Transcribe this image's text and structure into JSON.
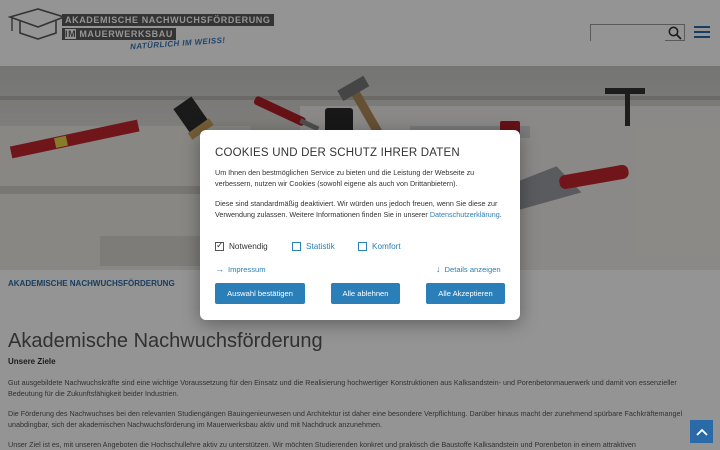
{
  "header": {
    "logo_line1": "AKADEMISCHE NACHWUCHSFÖRDERUNG",
    "logo_line2_box": "IM",
    "logo_line2": "MAUERWERKSBAU",
    "logo_tagline": "NATÜRLICH IM WEISS!",
    "search_placeholder": ""
  },
  "breadcrumb": "AKADEMISCHE NACHWUCHSFÖRDERUNG",
  "main": {
    "title": "Akademische Nachwuchsförderung",
    "subhead": "Unsere Ziele",
    "paragraphs": [
      "Gut ausgebildete Nachwuchskräfte sind eine wichtige Voraussetzung für den Einsatz und die Realisierung hochwertiger Konstruktionen aus Kalksandstein- und Porenbetonmauerwerk und damit von essenzieller Bedeutung für die Zukunftsfähigkeit beider Industrien.",
      "Die Förderung des Nachwuchses bei den relevanten Studiengängen Bauingenieurwesen und Architektur ist daher eine besondere Verpflichtung. Darüber hinaus macht der zunehmend spürbare Fachkräftemangel unabdingbar, sich der akademischen Nachwuchsförderung im Mauerwerksbau aktiv und mit Nachdruck anzunehmen.",
      "Unser Ziel ist es, mit unseren Angeboten die Hochschullehre aktiv zu unterstützen. Wir möchten Studierenden konkret und praktisch die Baustoffe Kalksandstein und Porenbeton in einem attraktiven"
    ]
  },
  "cookie": {
    "title": "COOKIES UND DER SCHUTZ IHRER DATEN",
    "text1": "Um Ihnen den bestmöglichen Service zu bieten und die Leistung der Webseite zu verbessern, nutzen wir Cookies (sowohl eigene als auch von Drittanbietern).",
    "text2": "Diese sind standardmäßig deaktiviert. Wir würden uns jedoch freuen, wenn Sie diese zur Verwendung zulassen. Weitere Informationen finden Sie in unserer",
    "privacy_link": "Datenschutzerklärung",
    "options": [
      {
        "label": "Notwendig",
        "checked": true
      },
      {
        "label": "Statistik",
        "checked": false
      },
      {
        "label": "Komfort",
        "checked": false
      }
    ],
    "impressum": "Impressum",
    "details": "Details anzeigen",
    "btn_confirm": "Auswahl bestätigen",
    "btn_reject": "Alle ablehnen",
    "btn_accept": "Alle Akzeptieren"
  },
  "colors": {
    "accent": "#2b7fb8",
    "nav_blue": "#2b6aa8",
    "logo_gray": "#5a5a5a"
  }
}
